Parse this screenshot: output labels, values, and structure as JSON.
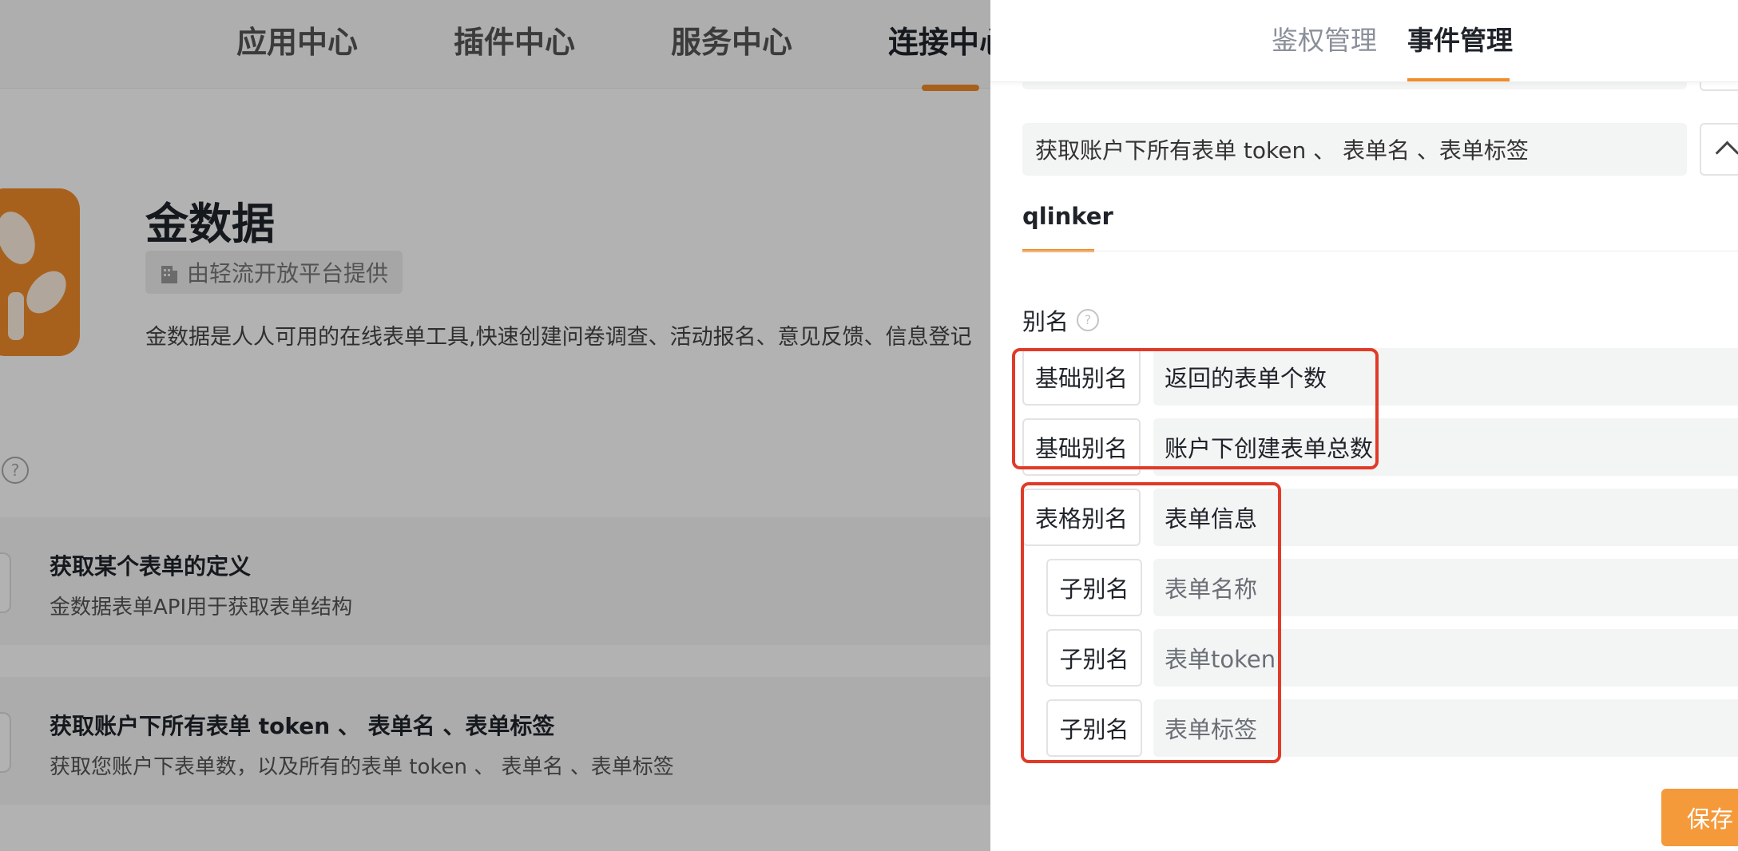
{
  "top_nav": {
    "items": [
      {
        "label": "应用中心"
      },
      {
        "label": "插件中心"
      },
      {
        "label": "服务中心"
      },
      {
        "label": "连接中心"
      }
    ]
  },
  "app": {
    "title": "金数据",
    "provider": "由轻流开放平台提供",
    "description": "金数据是人人可用的在线表单工具,快速创建问卷调查、活动报名、意见反馈、信息登记"
  },
  "api_list": [
    {
      "title": "获取某个表单的定义",
      "desc": "金数据表单API用于获取表单结构"
    },
    {
      "title": "获取账户下所有表单 token 、 表单名 、表单标签",
      "desc": "获取您账户下表单数，以及所有的表单 token 、 表单名 、表单标签"
    }
  ],
  "drawer": {
    "tabs": {
      "auth": "鉴权管理",
      "events": "事件管理"
    },
    "event_name": "获取账户下所有表单 token 、 表单名 、表单标签",
    "sub_tab": "qlinker",
    "alias_label": "别名",
    "alias_rows": [
      {
        "chip": "基础别名",
        "value": "返回的表单个数"
      },
      {
        "chip": "基础别名",
        "value": "账户下创建表单总数"
      },
      {
        "chip": "表格别名",
        "value": "表单信息"
      },
      {
        "chip": "子别名",
        "value": "表单名称"
      },
      {
        "chip": "子别名",
        "value": "表单token"
      },
      {
        "chip": "子别名",
        "value": "表单标签"
      }
    ],
    "save_label": "保存"
  },
  "colors": {
    "accent": "#f08c2a",
    "highlight": "#e03b28"
  }
}
